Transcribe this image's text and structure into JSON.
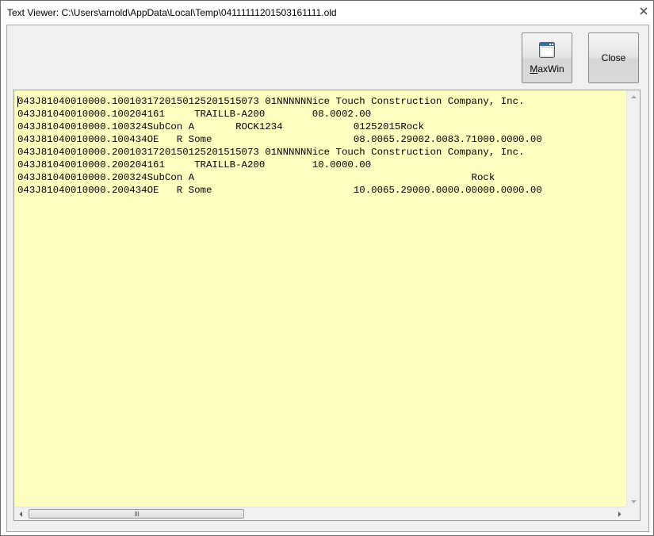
{
  "window": {
    "title": "Text Viewer: C:\\Users\\arnold\\AppData\\Local\\Temp\\04111111201503161111.old"
  },
  "toolbar": {
    "maxwin_label_mnemonic": "M",
    "maxwin_label_rest": "axWin",
    "close_label": "Close"
  },
  "viewer": {
    "background": "#ffffc0",
    "lines": [
      "043J81040010000.1001031720150125201515073 01NNNNNNice Touch Construction Company, Inc.",
      "043J81040010000.100204161     TRAILLB-A200        08.0002.00",
      "043J81040010000.100324SubCon A       ROCK1234            01252015Rock",
      "043J81040010000.100434OE   R Some                        08.0065.29002.0083.71000.0000.00",
      "043J81040010000.2001031720150125201515073 01NNNNNNice Touch Construction Company, Inc.",
      "043J81040010000.200204161     TRAILLB-A200        10.0000.00",
      "043J81040010000.200324SubCon A                                               Rock",
      "043J81040010000.200434OE   R Some                        10.0065.29000.0000.00000.0000.00"
    ]
  },
  "scrollbars": {
    "horizontal_thumb_fraction": 0.37
  }
}
